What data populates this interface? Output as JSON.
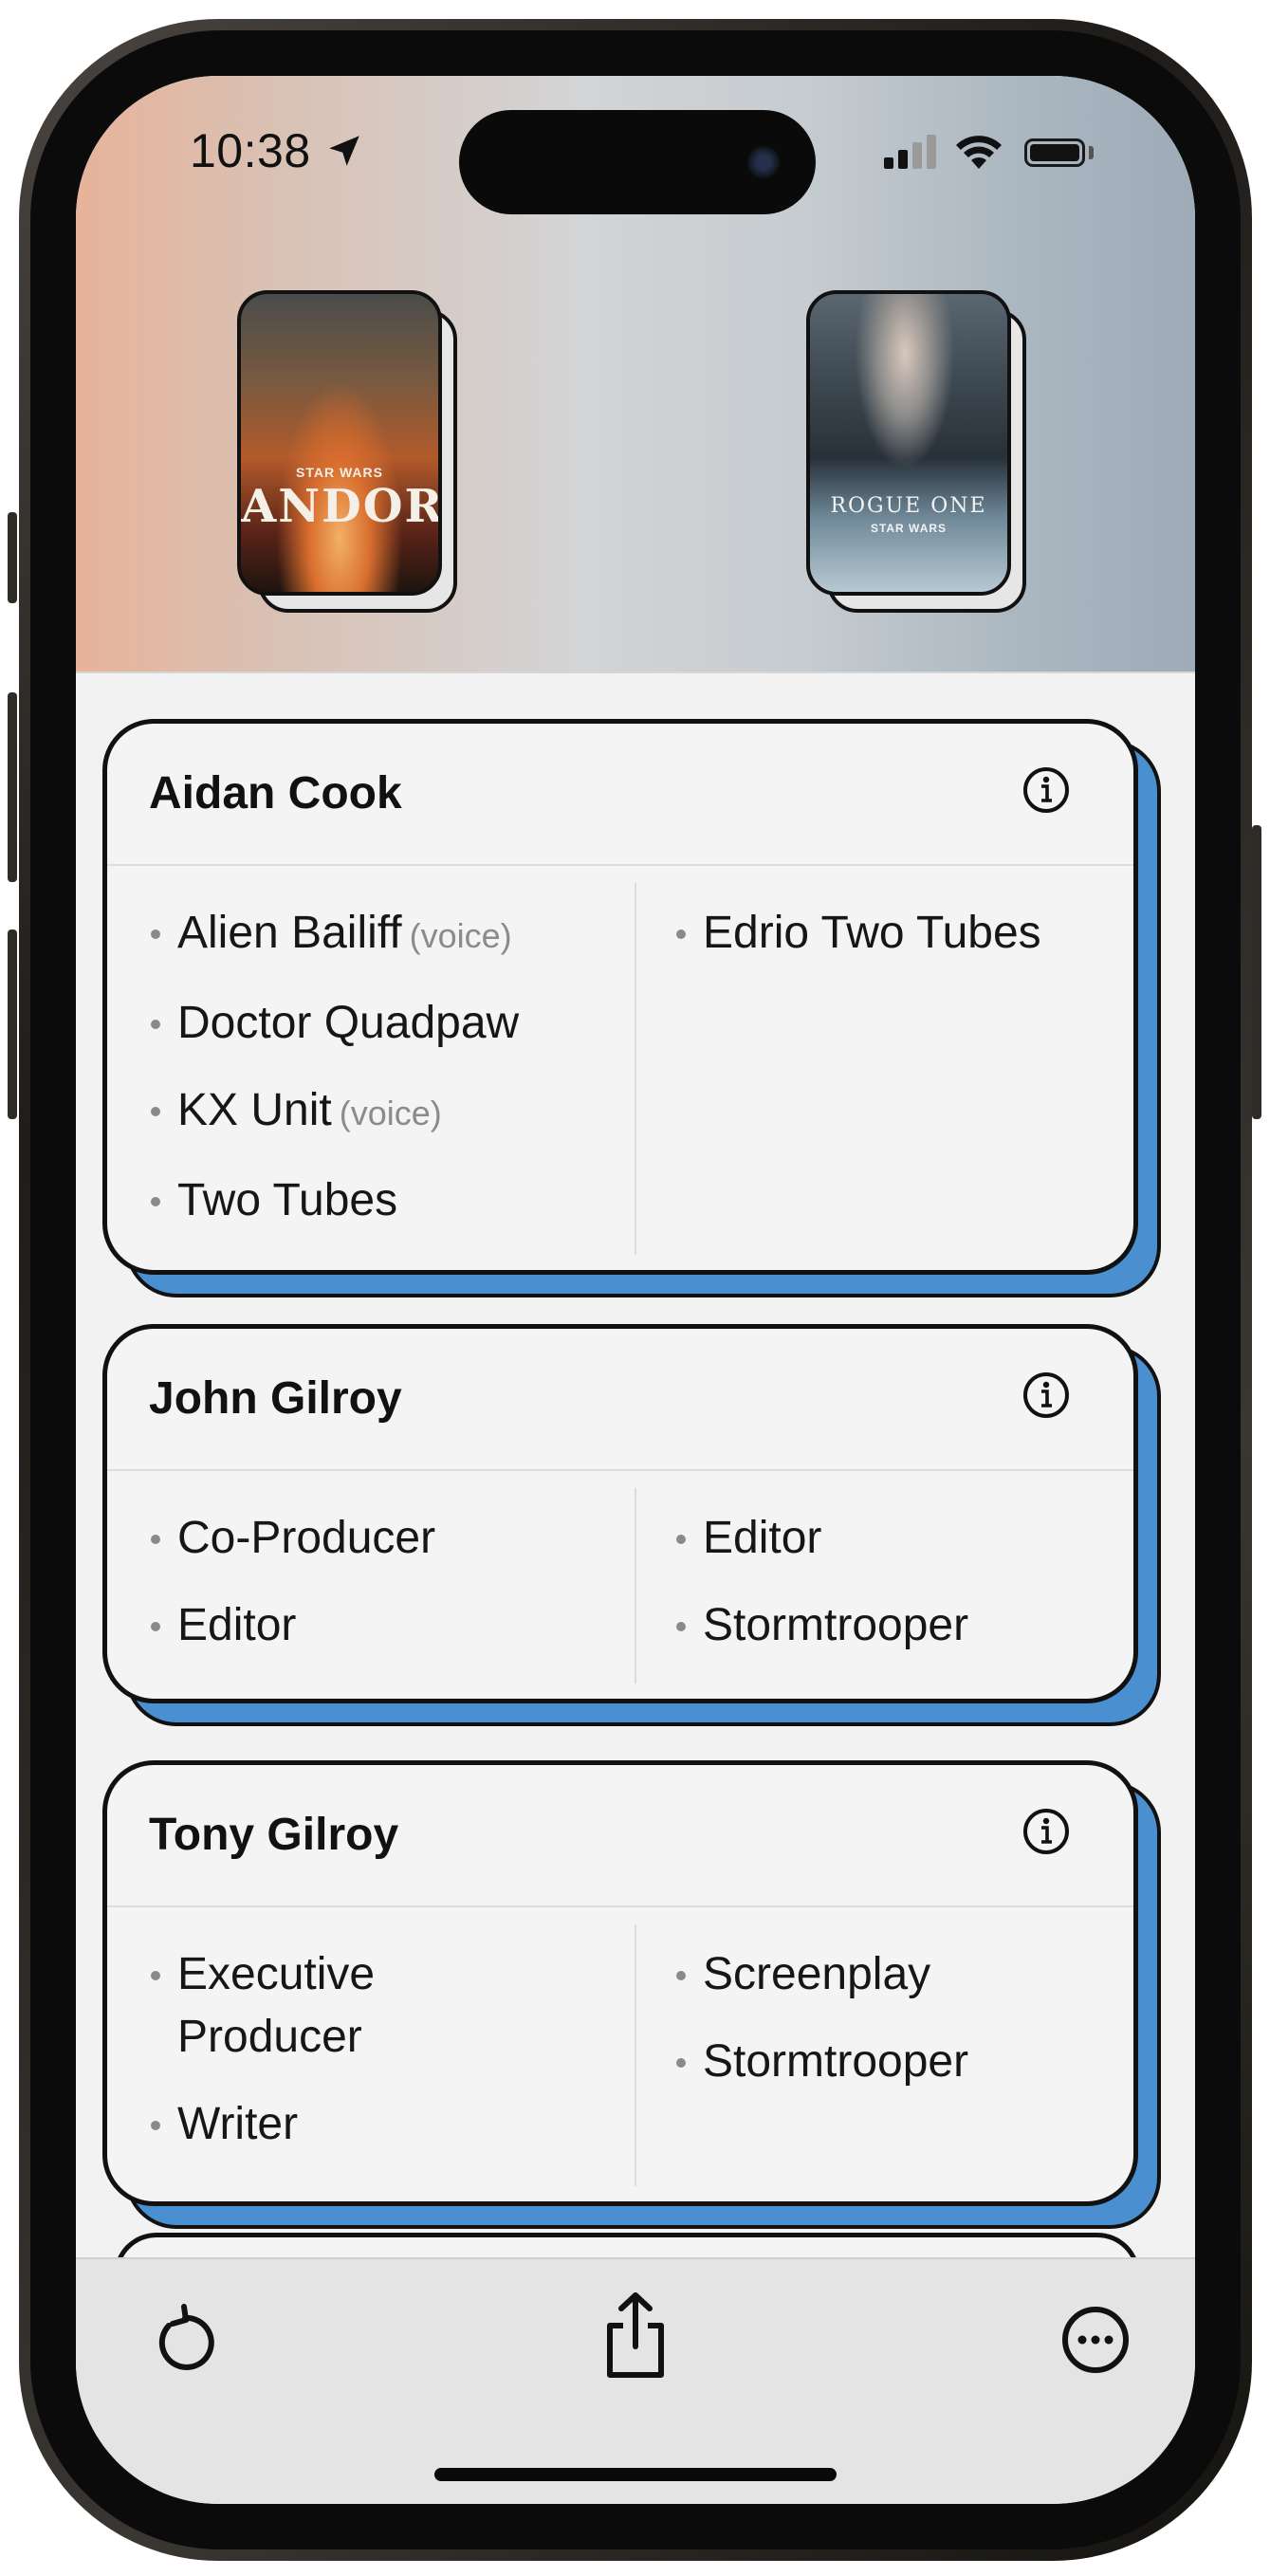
{
  "status_bar": {
    "time": "10:38"
  },
  "header": {
    "posters": [
      {
        "title": "ANDOR",
        "subtitle": "STAR WARS",
        "icon": "andor-poster"
      },
      {
        "title": "ROGUE ONE",
        "subtitle": "STAR WARS",
        "icon": "rogue-one-poster"
      }
    ]
  },
  "people": [
    {
      "name": "Aidan Cook",
      "left_roles": [
        {
          "role": "Alien Bailiff",
          "note": "(voice)"
        },
        {
          "role": "Doctor Quadpaw",
          "note": ""
        },
        {
          "role": "KX Unit",
          "note": "(voice)"
        },
        {
          "role": "Two Tubes",
          "note": ""
        }
      ],
      "right_roles": [
        {
          "role": "Edrio Two Tubes",
          "note": ""
        }
      ]
    },
    {
      "name": "John Gilroy",
      "left_roles": [
        {
          "role": "Co-Producer",
          "note": ""
        },
        {
          "role": "Editor",
          "note": ""
        }
      ],
      "right_roles": [
        {
          "role": "Editor",
          "note": ""
        },
        {
          "role": "Stormtrooper",
          "note": ""
        }
      ]
    },
    {
      "name": "Tony Gilroy",
      "left_roles": [
        {
          "role": "Executive Producer",
          "note": ""
        },
        {
          "role": "Writer",
          "note": ""
        }
      ],
      "right_roles": [
        {
          "role": "Screenplay",
          "note": ""
        },
        {
          "role": "Stormtrooper",
          "note": ""
        }
      ]
    }
  ],
  "toolbar": {
    "items": [
      "refresh-icon",
      "share-icon",
      "more-icon"
    ]
  },
  "colors": {
    "card_shadow": "#4a90d0",
    "card_bg": "#f4f4f4",
    "toolbar_bg": "#e4e4e4"
  }
}
